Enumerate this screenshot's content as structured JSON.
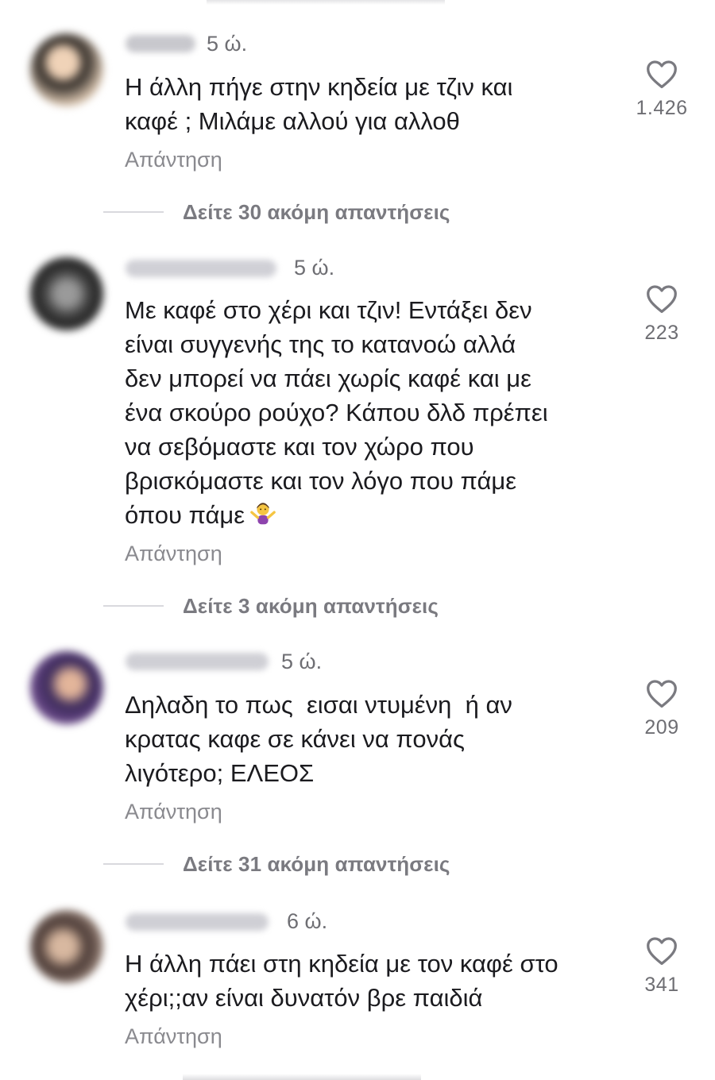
{
  "comments": [
    {
      "time": "5 ώ.",
      "text": "Η άλλη πήγε στην κηδεία με τζιν και\nκαφέ ; Μιλάμε αλλού για αλλοθ",
      "likes": "1.426",
      "reply_label": "Απάντηση",
      "more_replies": "Δείτε 30 ακόμη απαντήσεις"
    },
    {
      "time": "5 ώ.",
      "text": "Με καφέ στο χέρι και τζιν! Εντάξει δεν\nείναι συγγενής της το κατανοώ αλλά\nδεν μπορεί να πάει χωρίς καφέ και με\nένα σκούρο ρούχο? Κάπου δλδ πρέπει\nνα σεβόμαστε και τον χώρο που\nβρισκόμαστε και τον λόγο που πάμε\nόπου πάμε",
      "emoji": "woman-shrugging-emoji",
      "likes": "223",
      "reply_label": "Απάντηση",
      "more_replies": "Δείτε 3 ακόμη απαντήσεις"
    },
    {
      "time": "5 ώ.",
      "text": "Δηλαδη το πως  εισαι ντυμένη  ή αν\nκρατας καφε σε κάνει να πονάς\nλιγότερο; ΕΛΕΟΣ",
      "likes": "209",
      "reply_label": "Απάντηση",
      "more_replies": "Δείτε 31 ακόμη απαντήσεις"
    },
    {
      "time": "6 ώ.",
      "text": "Η άλλη πάει στη κηδεία με τον καφέ στο\nχέρι;;αν είναι δυνατόν βρε παιδιά",
      "likes": "341",
      "reply_label": "Απάντηση"
    }
  ],
  "icons": {
    "like": "heart-outline-icon"
  },
  "colors": {
    "text": "#1b1b1f",
    "secondary": "#6e6e73",
    "divider": "#d9d9de"
  }
}
